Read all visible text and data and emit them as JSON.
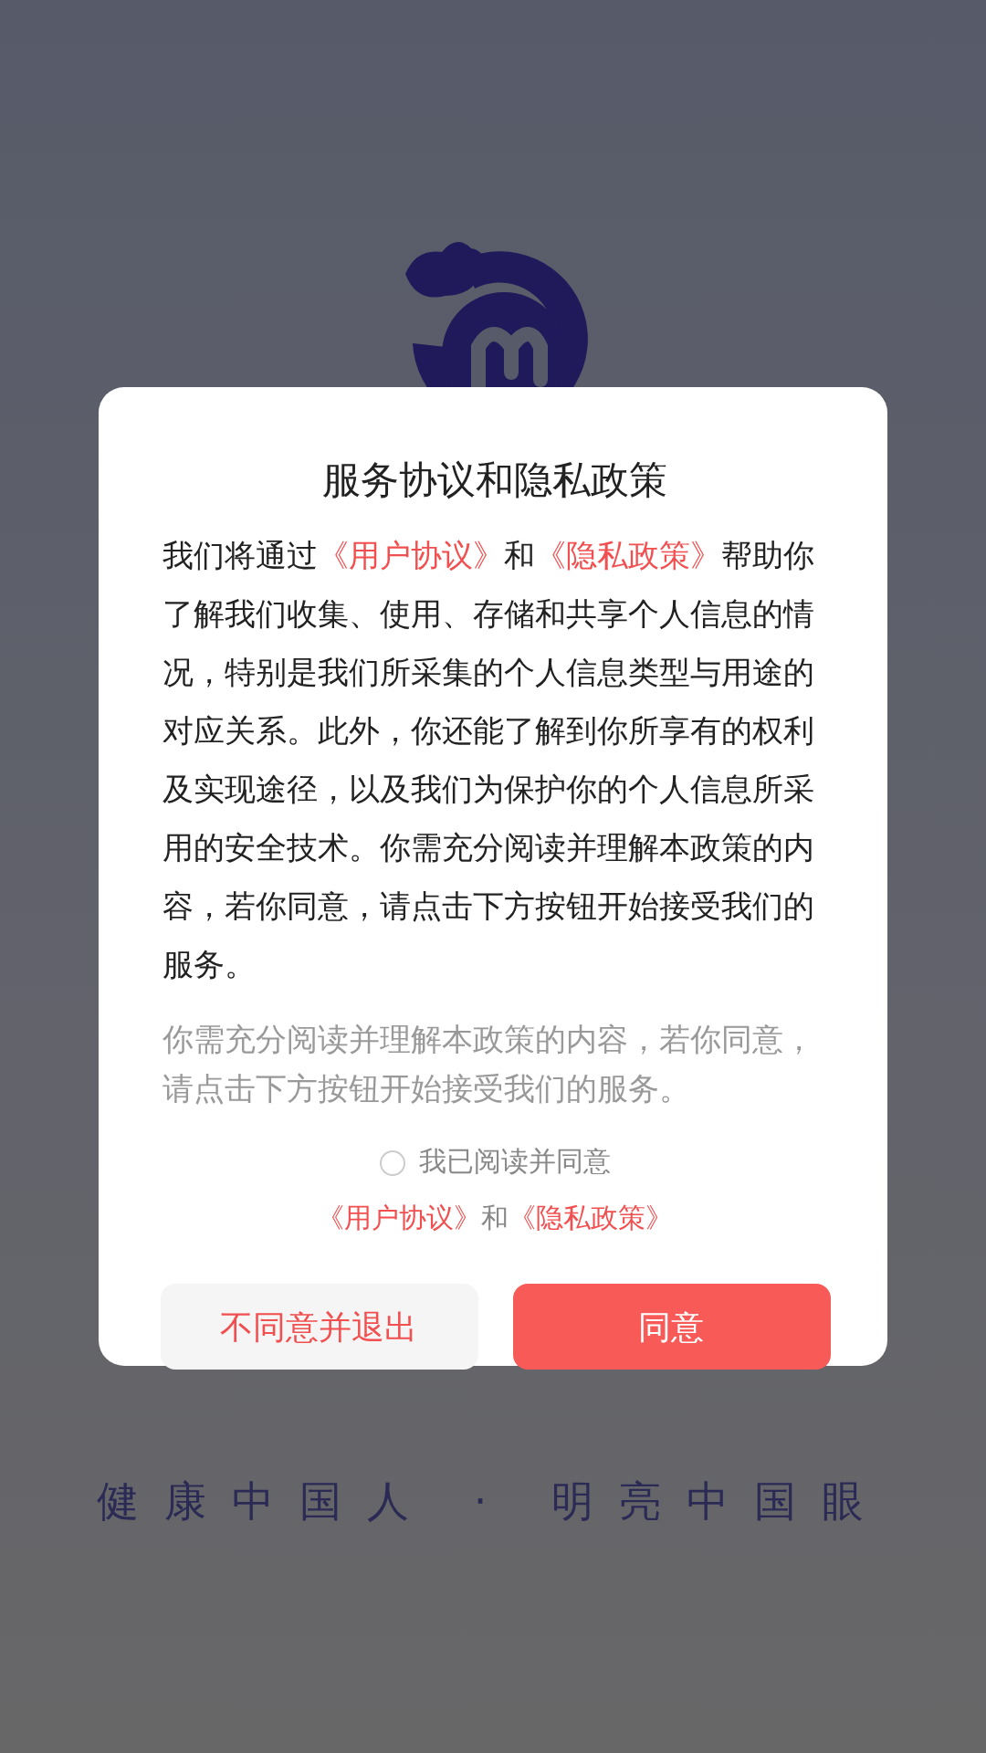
{
  "background": {
    "slogan": "健康中国人 · 明亮中国眼"
  },
  "dialog": {
    "title": "服务协议和隐私政策",
    "body": [
      {
        "kind": "plain",
        "text": "我们将通过"
      },
      {
        "kind": "link",
        "text": "《用户协议》"
      },
      {
        "kind": "plain",
        "text": "和"
      },
      {
        "kind": "link",
        "text": "《隐私政策》"
      },
      {
        "kind": "plain",
        "text": "帮助你了解我们收集、使用、存储和共享个人信息的情况，特别是我们所采集的个人信息类型与用途的对应关系。此外，你还能了解到你所享有的权利及实现途径，以及我们为保护你的个人信息所采用的安全技术。你需充分阅读并理解本政策的内容，若你同意，请点击下方按钮开始接受我们的服务。"
      }
    ],
    "note": "你需充分阅读并理解本政策的内容，若你同意，请点击下方按钮开始接受我们的服务。",
    "consent": {
      "label": "我已阅读并同意",
      "checked": false
    },
    "links": [
      {
        "kind": "link",
        "text": "《用户协议》"
      },
      {
        "kind": "plain",
        "text": "和"
      },
      {
        "kind": "link",
        "text": "《隐私政策》"
      }
    ],
    "buttons": [
      {
        "kind": "secondary",
        "label": "不同意并退出"
      },
      {
        "kind": "primary",
        "label": "同意"
      }
    ]
  }
}
